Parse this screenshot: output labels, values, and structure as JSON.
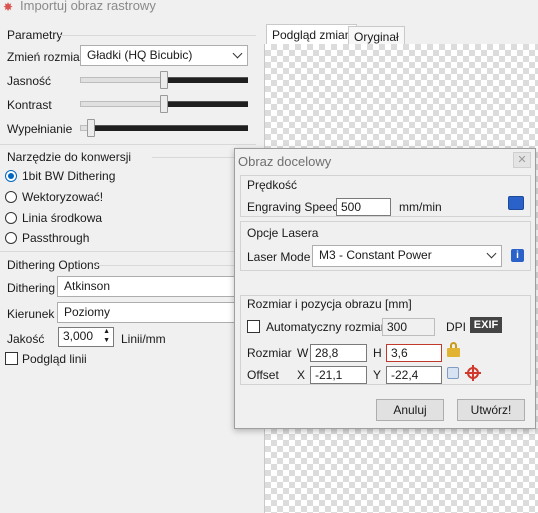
{
  "window": {
    "title": "Importuj obraz rastrowy"
  },
  "parametry": {
    "legend": "Parametry",
    "resize_label": "Zmień rozmiar",
    "resize_value": "Gładki (HQ Bicubic)",
    "brightness_label": "Jasność",
    "brightness_value": 0.5,
    "contrast_label": "Kontrast",
    "contrast_value": 0.5,
    "fill_label": "Wypełnianie",
    "fill_value": 0.05
  },
  "narzedzie": {
    "legend": "Narzędzie do konwersji",
    "options": [
      {
        "label": "1bit BW Dithering",
        "selected": true
      },
      {
        "label": "Wektoryzować!",
        "selected": false
      },
      {
        "label": "Linia środkowa",
        "selected": false
      },
      {
        "label": "Passthrough",
        "selected": false
      }
    ]
  },
  "dithering": {
    "legend": "Dithering Options",
    "dithering_label": "Dithering",
    "dithering_value": "Atkinson",
    "direction_label": "Kierunek",
    "direction_value": "Poziomy",
    "quality_label": "Jakość",
    "quality_value": "3,000",
    "quality_unit": "Linii/mm",
    "preview_label": "Podgląd linii"
  },
  "tabs": [
    {
      "label": "Podgląd zmian"
    },
    {
      "label": "Oryginał"
    }
  ],
  "dialog": {
    "title": "Obraz docelowy",
    "speed": {
      "legend": "Prędkość",
      "label": "Engraving Speed",
      "value": "500",
      "unit": "mm/min"
    },
    "laser": {
      "legend": "Opcje Lasera",
      "label": "Laser Mode",
      "value": "M3 - Constant Power"
    },
    "size": {
      "legend": "Rozmiar i pozycja obrazu [mm]",
      "auto_label": "Automatyczny rozmiar",
      "dpi_value": "300",
      "dpi_label": "DPI",
      "exif_label": "EXIF",
      "rozmiar_label": "Rozmiar",
      "w_label": "W",
      "w_value": "28,8",
      "h_label": "H",
      "h_value": "3,6",
      "offset_label": "Offset",
      "x_label": "X",
      "x_value": "-21,1",
      "y_label": "Y",
      "y_value": "-22,4"
    },
    "cancel_label": "Anuluj",
    "create_label": "Utwórz!"
  },
  "colors": {
    "accent": "#0067c0",
    "error_border": "#c0392b",
    "info": "#2a62c9"
  }
}
